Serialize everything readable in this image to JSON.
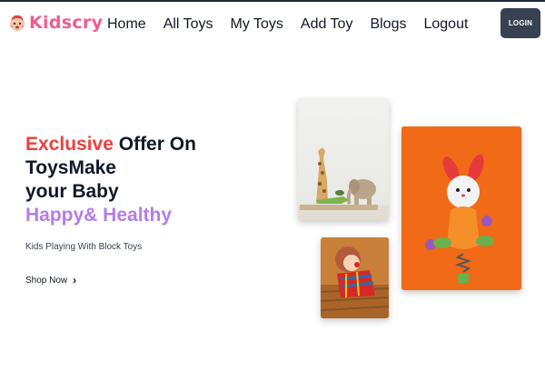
{
  "brand": {
    "name": "Kidscry"
  },
  "nav": {
    "items": [
      "Home",
      "All Toys",
      "My Toys",
      "Add Toy",
      "Blogs",
      "Logout"
    ]
  },
  "login_label": "LOGIN",
  "hero": {
    "title_highlight": "Exclusive",
    "title_line1_rest": " Offer On",
    "title_line2": "ToysMake",
    "title_line3": "your Baby",
    "title_line4": "Happy& Healthy",
    "subtitle": "Kids Playing With Block Toys",
    "cta": "Shop Now"
  },
  "colors": {
    "brand": "#ef5d8e",
    "accent_red": "#ef3e3e",
    "accent_purple": "#b57ce8",
    "button": "#374151",
    "orange_card": "#f06a17"
  },
  "icons": {
    "chevron": "chevron-right-icon",
    "logo": "kid-face-icon"
  }
}
